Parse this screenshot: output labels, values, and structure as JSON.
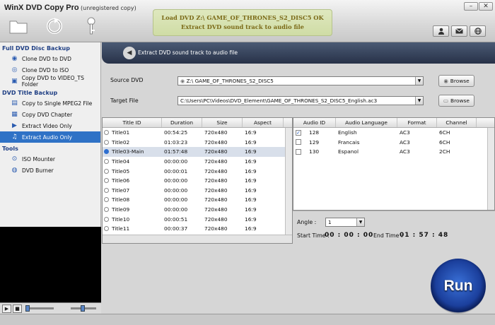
{
  "app": {
    "title": "WinX DVD Copy Pro",
    "subtitle": "(unregistered copy)"
  },
  "message": {
    "line1": "Load DVD Z:\\ GAME_OF_THRONES_S2_DISC5 OK",
    "line2": "Extract DVD sound track to audio file"
  },
  "toolbar": {
    "icons": [
      "folder-icon",
      "refresh-icon",
      "key-icon"
    ],
    "right_icons": [
      "user-icon",
      "mail-icon",
      "globe-icon"
    ]
  },
  "sidebar": {
    "sections": [
      {
        "title": "Full DVD Disc Backup",
        "items": [
          {
            "label": "Clone DVD to DVD",
            "icon": "disc-icon"
          },
          {
            "label": "Clone DVD to ISO",
            "icon": "iso-icon"
          },
          {
            "label": "Copy DVD to VIDEO_TS Folder",
            "icon": "folder-disc-icon"
          }
        ]
      },
      {
        "title": "DVD Title Backup",
        "items": [
          {
            "label": "Copy to Single MPEG2 File",
            "icon": "mpeg-icon"
          },
          {
            "label": "Copy DVD Chapter",
            "icon": "chapter-icon"
          },
          {
            "label": "Extract Video Only",
            "icon": "video-icon"
          },
          {
            "label": "Extract Audio Only",
            "icon": "audio-icon",
            "selected": true
          }
        ]
      },
      {
        "title": "Tools",
        "items": [
          {
            "label": "ISO Mounter",
            "icon": "mount-icon"
          },
          {
            "label": "DVD Burner",
            "icon": "burner-icon"
          }
        ]
      }
    ]
  },
  "header": {
    "text": "Extract DVD sound track to audio file"
  },
  "source": {
    "label": "Source DVD",
    "value": "Z:\\ GAME_OF_THRONES_S2_DISC5",
    "browse": "Browse"
  },
  "target": {
    "label": "Target File",
    "value": "C:\\Users\\PC\\Videos\\DVD_Element\\GAME_OF_THRONES_S2_DISC5_English.ac3",
    "browse": "Browse"
  },
  "titles_table": {
    "columns": [
      "Title ID",
      "Duration",
      "Size",
      "Aspect"
    ],
    "rows": [
      [
        "Title01",
        "00:54:25",
        "720x480",
        "16:9"
      ],
      [
        "Title02",
        "01:03:23",
        "720x480",
        "16:9"
      ],
      [
        "Title03-Main",
        "01:57:48",
        "720x480",
        "16:9"
      ],
      [
        "Title04",
        "00:00:00",
        "720x480",
        "16:9"
      ],
      [
        "Title05",
        "00:00:01",
        "720x480",
        "16:9"
      ],
      [
        "Title06",
        "00:00:00",
        "720x480",
        "16:9"
      ],
      [
        "Title07",
        "00:00:00",
        "720x480",
        "16:9"
      ],
      [
        "Title08",
        "00:00:00",
        "720x480",
        "16:9"
      ],
      [
        "Title09",
        "00:00:00",
        "720x480",
        "16:9"
      ],
      [
        "Title10",
        "00:00:51",
        "720x480",
        "16:9"
      ],
      [
        "Title11",
        "00:00:37",
        "720x480",
        "16:9"
      ]
    ],
    "selected_index": 2
  },
  "audio_table": {
    "columns": [
      "Audio ID",
      "Audio Language",
      "Format",
      "Channel"
    ],
    "rows": [
      {
        "id": "128",
        "lang": "English",
        "format": "AC3",
        "channel": "6CH",
        "checked": true
      },
      {
        "id": "129",
        "lang": "Francais",
        "format": "AC3",
        "channel": "6CH",
        "checked": false
      },
      {
        "id": "130",
        "lang": "Espanol",
        "format": "AC3",
        "channel": "2CH",
        "checked": false
      }
    ]
  },
  "options": {
    "angle_label": "Angle :",
    "angle_value": "1",
    "start_label": "Start Time :",
    "start_value": "00 : 00 : 00",
    "end_label": "End Time :",
    "end_value": "01 : 57 : 48"
  },
  "run_label": "Run",
  "player": {
    "play_icon": "play-icon",
    "stop_icon": "stop-icon"
  }
}
